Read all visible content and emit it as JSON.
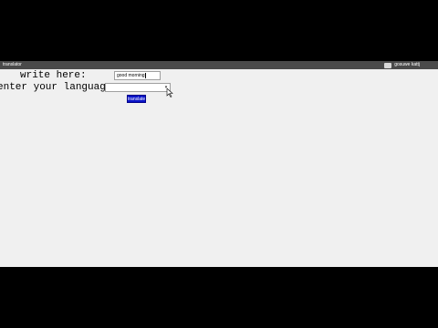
{
  "window": {
    "title": "translator",
    "user_name": "gosuwe kattj"
  },
  "form": {
    "write_label": "write here:",
    "text_value": "good morning",
    "language_label": "enter your language",
    "language_selected": "",
    "translate_button_label": "translate"
  },
  "icons": {
    "user": "user-icon",
    "dropdown": "chevron-down-icon",
    "cursor": "mouse-pointer-icon"
  },
  "colors": {
    "button_bg": "#0a14c8",
    "titlebar_bg": "#4a4a4a",
    "window_bg": "#f0f0f0"
  }
}
